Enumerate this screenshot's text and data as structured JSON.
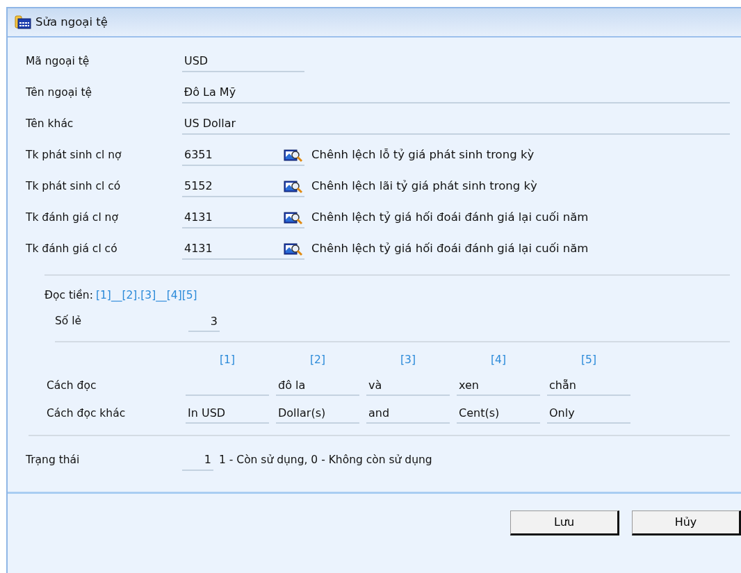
{
  "window": {
    "title": "Sửa ngoại tệ"
  },
  "fields": [
    {
      "kind": "short",
      "label": "Mã ngoại tệ",
      "value": "USD"
    },
    {
      "kind": "wide",
      "label": "Tên ngoại tệ",
      "value": "Đô La Mỹ"
    },
    {
      "kind": "wide",
      "label": "Tên khác",
      "value": "US Dollar"
    },
    {
      "kind": "lookup",
      "label": "Tk phát sinh cl nợ",
      "value": "6351",
      "description": "Chênh lệch lỗ tỷ giá phát sinh trong kỳ"
    },
    {
      "kind": "lookup",
      "label": "Tk phát sinh cl có",
      "value": "5152",
      "description": "Chênh lệch lãi tỷ giá phát sinh trong kỳ"
    },
    {
      "kind": "lookup",
      "label": "Tk đánh giá cl nợ",
      "value": "4131",
      "description": "Chênh lệch tỷ giá hối đoái đánh giá lại cuối năm"
    },
    {
      "kind": "lookup",
      "label": "Tk đánh giá cl có",
      "value": "4131",
      "description": "Chênh lệch tỷ giá hối đoái đánh giá lại cuối năm"
    }
  ],
  "reading": {
    "label": "Đọc tiền:",
    "pattern": "[1]__[2].[3]__[4][5]",
    "decimals_label": "Số lẻ",
    "decimals": "3"
  },
  "reading_table": {
    "columns": [
      "[1]",
      "[2]",
      "[3]",
      "[4]",
      "[5]"
    ],
    "rows": [
      {
        "label": "Cách đọc",
        "cells": [
          "",
          "đô la",
          "và",
          "xen",
          "chẵn"
        ]
      },
      {
        "label": "Cách đọc khác",
        "cells": [
          "In USD",
          "Dollar(s)",
          "and",
          "Cent(s)",
          "Only"
        ]
      }
    ]
  },
  "status": {
    "label": "Trạng thái",
    "value": "1",
    "note": "1 - Còn sử dụng, 0 - Không còn sử dụng"
  },
  "buttons": [
    "Lưu",
    "Hủy"
  ]
}
